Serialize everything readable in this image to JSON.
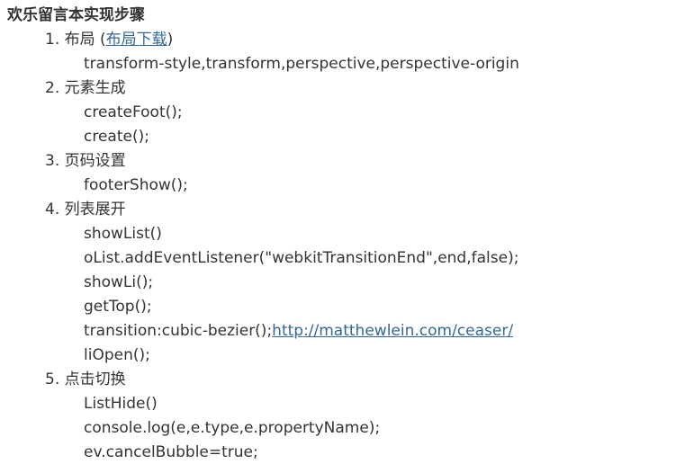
{
  "title": "欢乐留言本实现步骤",
  "steps": [
    {
      "label": "1. 布局",
      "link_open": " (",
      "link_text": "布局下载",
      "link_close": ")",
      "lines": [
        "transform-style,transform,perspective,perspective-origin"
      ]
    },
    {
      "label": "2. 元素生成",
      "lines": [
        "createFoot();",
        "create();"
      ]
    },
    {
      "label": "3. 页码设置",
      "lines": [
        "footerShow();"
      ]
    },
    {
      "label": "4. 列表展开",
      "lines": [
        "showList()",
        "oList.addEventListener(\"webkitTransitionEnd\",end,false);",
        "showLi();",
        "getTop();",
        "transition:cubic-bezier();",
        "liOpen();"
      ],
      "transition_link": "http://matthewlein.com/ceaser/"
    },
    {
      "label": "5. 点击切换",
      "lines": [
        "ListHide()",
        "console.log(e,e.type,e.propertyName);",
        "ev.cancelBubble=true;"
      ]
    }
  ],
  "colors": {
    "text": "#333333",
    "link": "#336699"
  }
}
